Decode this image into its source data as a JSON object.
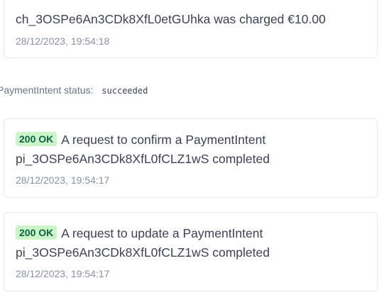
{
  "charge_event": {
    "message": "ch_3OSPe6An3CDk8XfL0etGUhka was charged €10.00",
    "timestamp": "28/12/2023, 19:54:18"
  },
  "payment_intent_status": {
    "label": "PaymentIntent status:",
    "value": "succeeded"
  },
  "events": [
    {
      "badge": "200 OK",
      "message_line1": "A request to confirm a PaymentIntent",
      "message_line2": "pi_3OSPe6An3CDk8XfL0fCLZ1wS completed",
      "timestamp": "28/12/2023, 19:54:17"
    },
    {
      "badge": "200 OK",
      "message_line1": "A request to update a PaymentIntent",
      "message_line2": "pi_3OSPe6An3CDk8XfL0fCLZ1wS completed",
      "timestamp": "28/12/2023, 19:54:17"
    }
  ],
  "colors": {
    "badge_bg": "#cbf4c9",
    "badge_text": "#0e6245",
    "border": "#e3e8ee",
    "timestamp": "#8792a2"
  }
}
